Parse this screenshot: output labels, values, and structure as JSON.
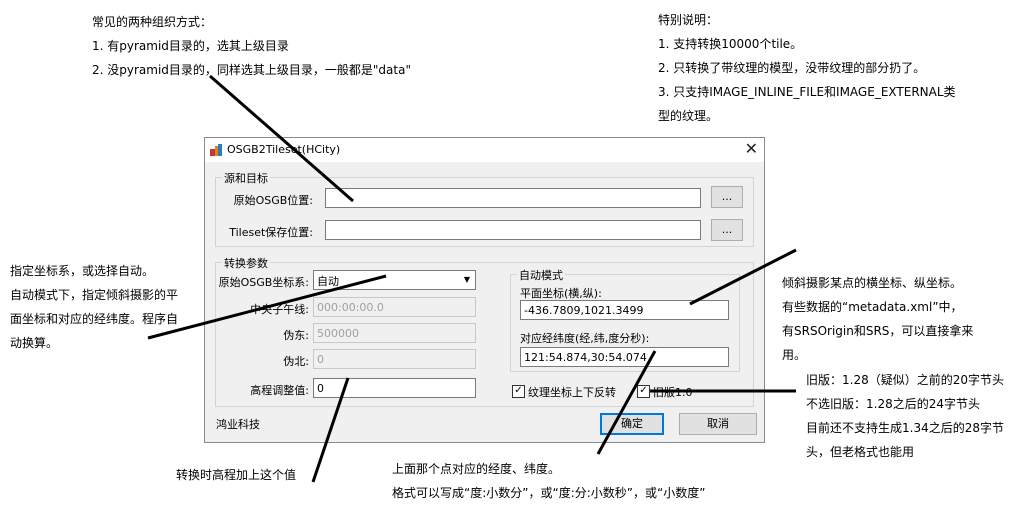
{
  "notes": {
    "top_left": {
      "title": "常见的两种组织方式：",
      "lines": [
        "1. 有pyramid目录的，选其上级目录",
        "2. 没pyramid目录的，同样选其上级目录，一般都是\"data\""
      ]
    },
    "top_right": {
      "title": "特别说明：",
      "lines": [
        "1. 支持转换10000个tile。",
        "2. 只转换了带纹理的模型，没带纹理的部分扔了。",
        "3. 只支持IMAGE_INLINE_FILE和IMAGE_EXTERNAL类",
        "型的纹理。"
      ]
    },
    "left_mid": {
      "lines": [
        "指定坐标系，或选择自动。",
        "自动模式下，指定倾斜摄影的平",
        "面坐标和对应的经纬度。程序自",
        "动换算。"
      ]
    },
    "right_mid": {
      "lines": [
        "倾斜摄影某点的横坐标、纵坐标。",
        "有些数据的“metadata.xml”中，",
        "有SRSOrigin和SRS，可以直接拿来",
        "用。"
      ]
    },
    "right_low": {
      "lines": [
        "旧版：1.28（疑似）之前的20字节头",
        "不选旧版：1.28之后的24字节头",
        "目前还不支持生成1.34之后的28字节",
        "头，但老格式也能用"
      ]
    },
    "bottom_left": {
      "lines": [
        "转换时高程加上这个值"
      ]
    },
    "bottom_center": {
      "lines": [
        "上面那个点对应的经度、纬度。",
        "格式可以写成“度:小数分”，或“度:分:小数秒”，或“小数度”"
      ]
    }
  },
  "dialog": {
    "title": "OSGB2Tileset(HCity)",
    "close_glyph": "✕",
    "source_group": {
      "title": "源和目标",
      "osgb_label": "原始OSGB位置:",
      "osgb_value": "",
      "tileset_label": "Tileset保存位置:",
      "tileset_value": "",
      "browse_label": "..."
    },
    "params_group": {
      "title": "转换参数",
      "crs_label": "原始OSGB坐标系:",
      "crs_value": "自动",
      "meridian_label": "中央子午线:",
      "meridian_value": "000:00:00.0",
      "false_east_label": "伪东:",
      "false_east_value": "500000",
      "false_north_label": "伪北:",
      "false_north_value": "0",
      "elev_label": "高程调整值:",
      "elev_value": "0"
    },
    "auto_group": {
      "title": "自动模式",
      "plane_label": "平面坐标(横,纵):",
      "plane_value": "-436.7809,1021.3499",
      "lonlat_label": "对应经纬度(经,纬,度分秒):",
      "lonlat_value": "121:54.874,30:54.074"
    },
    "flip_texture_label": "纹理坐标上下反转",
    "flip_texture_checked": true,
    "old_version_label": "旧版1.0",
    "old_version_checked": true,
    "check_glyph": "✓",
    "company": "鸿业科技",
    "ok_label": "确定",
    "cancel_label": "取消"
  }
}
